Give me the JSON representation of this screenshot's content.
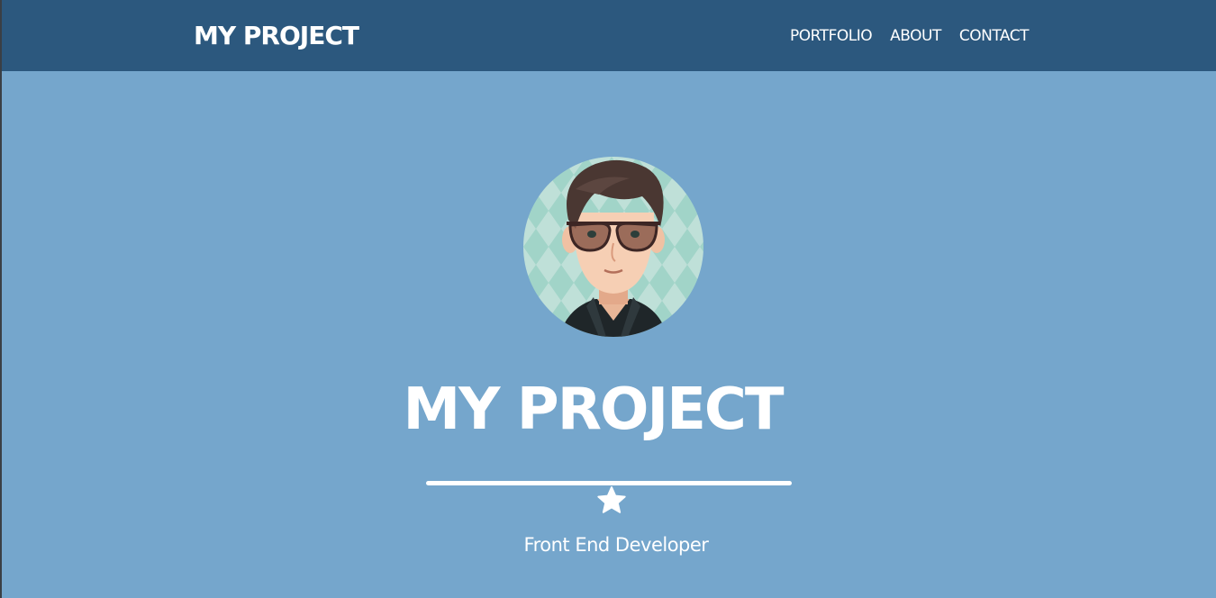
{
  "navbar": {
    "brand": "MY PROJECT",
    "links": [
      {
        "label": "PORTFOLIO"
      },
      {
        "label": "ABOUT"
      },
      {
        "label": "CONTACT"
      }
    ]
  },
  "hero": {
    "avatar_icon": "avatar-image",
    "title": "MY PROJECT",
    "divider_icon": "star-icon",
    "subtitle": "Front End Developer"
  },
  "colors": {
    "navbar_bg": "#2c587e",
    "hero_bg": "#75a6cc",
    "text": "#ffffff"
  }
}
